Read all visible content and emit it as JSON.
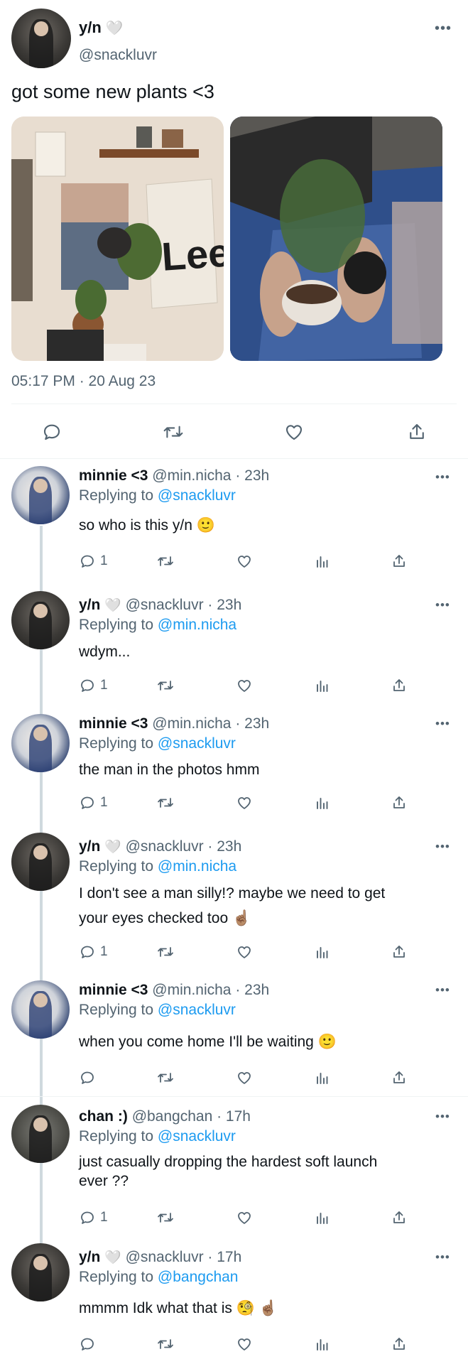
{
  "tweet": {
    "author_name": "y/n",
    "heart_emoji": "🤍",
    "author_handle": "@snackluvr",
    "text": "got some new plants <3",
    "timestamp": "05:17 PM · 20 Aug 23",
    "more": "•••"
  },
  "replies": [
    {
      "name": "minnie <3",
      "heart": "",
      "handle": "@min.nicha",
      "time": "· 23h",
      "replying_label": "Replying to",
      "replying_to": "@snackluvr",
      "text": "so who is this y/n 🙂",
      "reply_count": "1"
    },
    {
      "name": "y/n",
      "heart": "🤍",
      "handle": "@snackluvr",
      "time": "· 23h",
      "replying_label": "Replying to",
      "replying_to": "@min.nicha",
      "text": "wdym...",
      "reply_count": "1"
    },
    {
      "name": "minnie <3",
      "heart": "",
      "handle": "@min.nicha",
      "time": "· 23h",
      "replying_label": "Replying to",
      "replying_to": "@snackluvr",
      "text": "the man in the photos hmm",
      "reply_count": "1"
    },
    {
      "name": "y/n",
      "heart": "🤍",
      "handle": "@snackluvr",
      "time": "· 23h",
      "replying_label": "Replying to",
      "replying_to": "@min.nicha",
      "text_line1": "I don't see a man silly!? maybe we need to get",
      "text_line2": "your eyes checked too ☝🏽",
      "reply_count": "1"
    },
    {
      "name": "minnie <3",
      "heart": "",
      "handle": "@min.nicha",
      "time": "· 23h",
      "replying_label": "Replying to",
      "replying_to": "@snackluvr",
      "text": "when you come home I'll be waiting 🙂",
      "reply_count": ""
    },
    {
      "name": "chan :)",
      "heart": "",
      "handle": "@bangchan",
      "time": "· 17h",
      "replying_label": "Replying to",
      "replying_to": "@snackluvr",
      "text_line1": "just casually dropping the hardest soft launch",
      "text_line2": "ever ??",
      "reply_count": "1"
    },
    {
      "name": "y/n",
      "heart": "🤍",
      "handle": "@snackluvr",
      "time": "· 17h",
      "replying_label": "Replying to",
      "replying_to": "@bangchan",
      "text": "mmmm Idk what that is 🧐 ☝🏽",
      "reply_count": ""
    }
  ],
  "colors": {
    "accent": "#1d9bf0",
    "muted": "#536471",
    "thread": "#cfd9de"
  },
  "icons": [
    "reply-icon",
    "retweet-icon",
    "like-icon",
    "views-icon",
    "share-icon",
    "more-icon"
  ]
}
